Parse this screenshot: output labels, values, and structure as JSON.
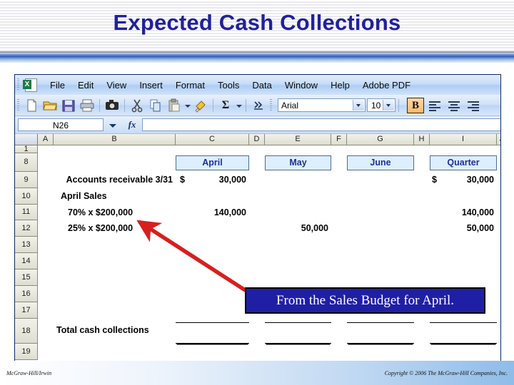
{
  "slide": {
    "title": "Expected Cash Collections"
  },
  "excel": {
    "logo_letter": "X",
    "menu": [
      {
        "label": "File"
      },
      {
        "label": "Edit"
      },
      {
        "label": "View"
      },
      {
        "label": "Insert"
      },
      {
        "label": "Format"
      },
      {
        "label": "Tools"
      },
      {
        "label": "Data"
      },
      {
        "label": "Window"
      },
      {
        "label": "Help"
      },
      {
        "label": "Adobe PDF"
      }
    ],
    "toolbar": {
      "icons": [
        "new-document-icon",
        "open-folder-icon",
        "save-icon",
        "print-icon",
        "camera-icon",
        "cut-scissors-icon",
        "copy-icon",
        "paste-icon",
        "format-painter-icon",
        "autosum-sigma-icon",
        "toolbar-overflow-icon"
      ],
      "sigma_glyph": "Σ",
      "font_name": "Arial",
      "font_size": "10",
      "bold_label": "B"
    },
    "formula_bar": {
      "name_box": "N26",
      "fx_label": "fx",
      "formula_value": ""
    },
    "grid": {
      "columns": [
        "A",
        "B",
        "C",
        "D",
        "E",
        "F",
        "G",
        "H",
        "I",
        "J"
      ],
      "rows": [
        "1",
        "8",
        "9",
        "10",
        "11",
        "12",
        "13",
        "14",
        "15",
        "16",
        "17",
        "18",
        "19"
      ],
      "header_cells": {
        "april": "April",
        "may": "May",
        "june": "June",
        "quarter": "Quarter"
      },
      "r9": {
        "label": "Accounts receivable 3/31",
        "april_sym": "$",
        "april_val": "30,000",
        "may_val": "",
        "june_val": "",
        "quarter_sym": "$",
        "quarter_val": "30,000"
      },
      "r10": {
        "label": "April Sales"
      },
      "r11": {
        "label": "70% x $200,000",
        "april_val": "140,000",
        "quarter_val": "140,000"
      },
      "r12": {
        "label": "25% x $200,000",
        "may_val": "50,000",
        "quarter_val": "50,000"
      },
      "r18": {
        "label": "Total cash collections",
        "april_val": "",
        "may_val": "",
        "june_val": "",
        "quarter_val": ""
      }
    }
  },
  "annotation": {
    "callout_text": "From the Sales Budget for April.",
    "arrow_color": "#d81f1f"
  },
  "footer": {
    "left": "McGraw-Hill/Irwin",
    "right": "Copyright © 2006 The McGraw-Hill Companies, Inc."
  }
}
